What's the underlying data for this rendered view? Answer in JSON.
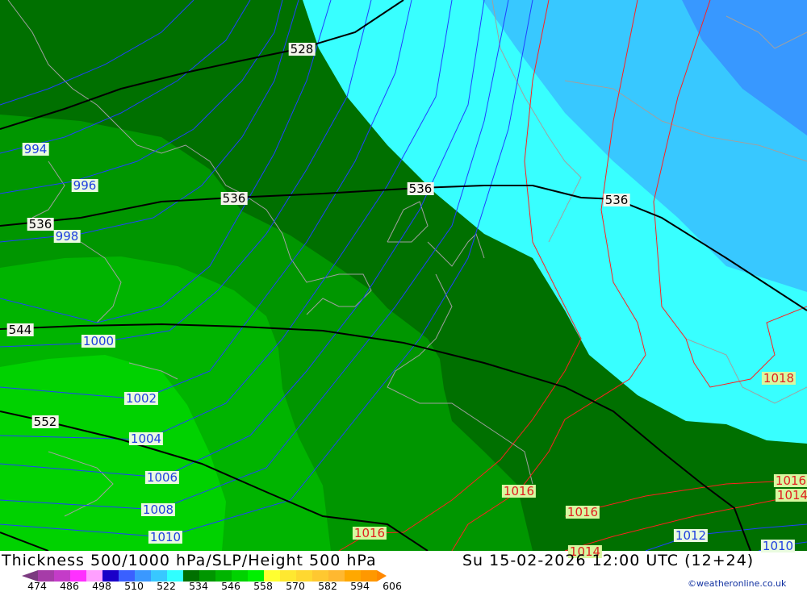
{
  "title": "Thickness 500/1000 hPa/SLP/Height 500 hPa",
  "datetime": "Su 15-02-2026 12:00 UTC (12+24)",
  "copyright": "©weatheronline.co.uk",
  "legend": {
    "ticks": [
      "474",
      "486",
      "498",
      "510",
      "522",
      "534",
      "546",
      "558",
      "570",
      "582",
      "594",
      "606"
    ],
    "colors": [
      "#7b3a80",
      "#a63ca8",
      "#c43cc8",
      "#ff30ff",
      "#ffa0ff",
      "#1a00c8",
      "#3a60ff",
      "#3a98ff",
      "#38c8ff",
      "#30ffff",
      "#007000",
      "#009600",
      "#00b400",
      "#00d200",
      "#00f000",
      "#ffff30",
      "#ffe830",
      "#ffd830",
      "#ffc830",
      "#ffb830",
      "#ffa800",
      "#ff9800",
      "#ff8800"
    ]
  },
  "map_colors": {
    "cyan": "#38ffff",
    "light_blue": "#38c8ff",
    "blue": "#3898ff",
    "dark_green": "#007000",
    "green": "#009600",
    "mid_green": "#00b400",
    "light_green": "#00d200",
    "thickness_line": "#000000",
    "isobar_low": "#2040ff",
    "isobar_high": "#ff2020",
    "coastline": "#a0a0a0"
  },
  "thickness_labels": [
    "528",
    "536",
    "536",
    "536",
    "536",
    "544",
    "552"
  ],
  "isobar_labels_blue": [
    "994",
    "996",
    "998",
    "1000",
    "1002",
    "1004",
    "1006",
    "1008",
    "1010",
    "1012",
    "1010"
  ],
  "isobar_labels_red": [
    "1016",
    "1016",
    "1016",
    "1018",
    "1016",
    "1014",
    "1014"
  ]
}
